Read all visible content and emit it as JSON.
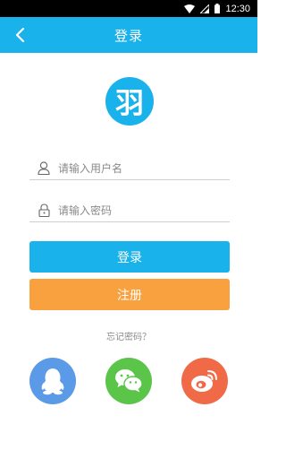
{
  "status_bar": {
    "time": "12:30"
  },
  "app_bar": {
    "title": "登录",
    "back_icon": "back-arrow-icon"
  },
  "logo": {
    "text": "羽",
    "color": "#1ab2ea"
  },
  "form": {
    "username": {
      "placeholder": "请输入用户名",
      "value": "",
      "icon": "user-icon"
    },
    "password": {
      "placeholder": "请输入密码",
      "value": "",
      "icon": "lock-icon"
    }
  },
  "buttons": {
    "login_label": "登录",
    "register_label": "注册"
  },
  "forgot_password": "忘记密码？",
  "social_logins": [
    {
      "name": "QQ",
      "icon": "qq-penguin-icon",
      "color": "#5a9ae6"
    },
    {
      "name": "WeChat",
      "icon": "wechat-icon",
      "color": "#5bc54a"
    },
    {
      "name": "Weibo",
      "icon": "weibo-icon",
      "color": "#f06a48"
    }
  ],
  "colors": {
    "primary": "#1ab2ea",
    "accent": "#f9a03f"
  }
}
